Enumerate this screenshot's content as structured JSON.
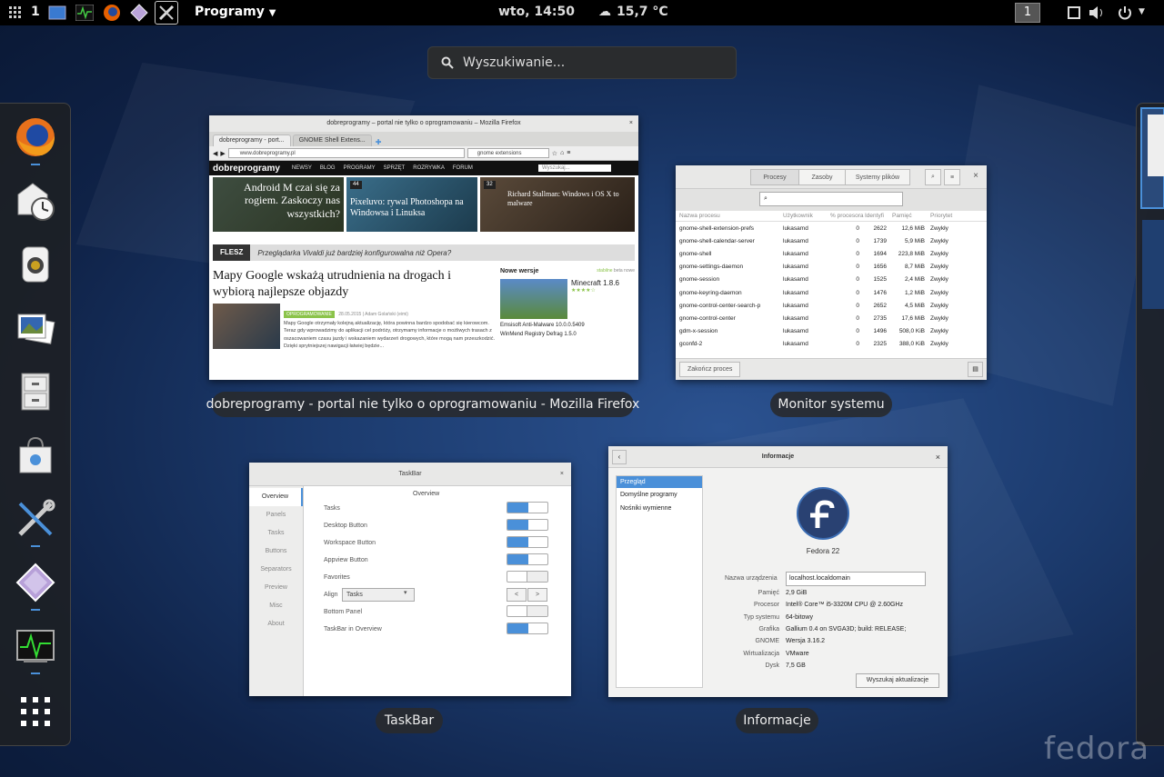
{
  "topbar": {
    "workspace_num": "1",
    "apps_menu": "Programy",
    "clock": "wto, 14:50",
    "weather": "15,7 °C",
    "workspace_indicator": "1"
  },
  "search": {
    "placeholder": "Wyszukiwanie..."
  },
  "dash": {
    "items": [
      "firefox",
      "mail-clock",
      "speaker",
      "image-viewer",
      "file-cabinet",
      "software-store",
      "tweak-tool",
      "gem-app",
      "system-monitor",
      "show-apps"
    ]
  },
  "windows": {
    "firefox": {
      "caption": "dobreprogramy - portal nie tylko o oprogramowaniu - Mozilla Firefox",
      "title": "dobreprogramy – portal nie tylko o oprogramowaniu – Mozilla Firefox",
      "tab1": "dobreprogramy - port...",
      "tab2": "GNOME Shell Extens...",
      "url": "www.dobreprogramy.pl",
      "search": "gnome extensions",
      "site_logo": "dobreprogramy",
      "nav": [
        "NEWSY",
        "BLOG",
        "PROGRAMY",
        "SPRZĘT",
        "ROZRYWKA",
        "FORUM"
      ],
      "site_search": "Wyszukaj...",
      "card1": "Android M czai się za rogiem. Zaskoczy nas wszystkich?",
      "card2": "Pixeluvo: rywal Photoshopa na Windowsa i Linuksa",
      "card2_badge": "44",
      "card3": "Richard Stallman: Windows i OS X to malware",
      "card3_badge": "32",
      "flesz_label": "FLESZ",
      "flesz_text": "Przeglądarka Vivaldi już bardziej konfigurowalna niż Opera?",
      "headline": "Mapy Google wskażą utrudnienia na drogach i wybiorą najlepsze objazdy",
      "headline_badge": "5",
      "tag": "OPROGRAMOWANIE",
      "meta": "28.05.2015 | Adam Golański (eimi)",
      "body": "Mapy Google otrzymały kolejną aktualizację, która powinna bardzo spodobać się kierowcom. Teraz gdy wprowadzimy do aplikacji cel podróży, otrzymamy informacje o możliwych trasach z oszacowaniem czasu jazdy i wskazaniem wydarzeń drogowych, które mogą nam przeszkodzić. Dzięki sprytniejszej nawigacji łatwiej będzie...",
      "new_versions": "Nowe wersje",
      "nv_tabs": [
        "stabilne",
        "beta",
        "nowe"
      ],
      "minecraft": "Minecraft 1.8.6",
      "nv1": "Emsisoft Anti-Malware 10.0.0.5409",
      "nv2": "WinMend Registry Defrag 1.5.0"
    },
    "monitor": {
      "caption": "Monitor systemu",
      "tabs": [
        "Procesy",
        "Zasoby",
        "Systemy plików"
      ],
      "columns": [
        "Nazwa procesu",
        "Użytkownik",
        "% procesora",
        "Identyfi",
        "Pamięć",
        "Priorytet"
      ],
      "rows": [
        [
          "gnome-shell-extension-prefs",
          "lukasamd",
          "0",
          "2622",
          "12,6 MiB",
          "Zwykły"
        ],
        [
          "gnome-shell-calendar-server",
          "lukasamd",
          "0",
          "1739",
          "5,9 MiB",
          "Zwykły"
        ],
        [
          "gnome-shell",
          "lukasamd",
          "0",
          "1694",
          "223,8 MiB",
          "Zwykły"
        ],
        [
          "gnome-settings-daemon",
          "lukasamd",
          "0",
          "1656",
          "8,7 MiB",
          "Zwykły"
        ],
        [
          "gnome-session",
          "lukasamd",
          "0",
          "1525",
          "2,4 MiB",
          "Zwykły"
        ],
        [
          "gnome-keyring-daemon",
          "lukasamd",
          "0",
          "1476",
          "1,2 MiB",
          "Zwykły"
        ],
        [
          "gnome-control-center-search-p",
          "lukasamd",
          "0",
          "2652",
          "4,5 MiB",
          "Zwykły"
        ],
        [
          "gnome-control-center",
          "lukasamd",
          "0",
          "2735",
          "17,6 MiB",
          "Zwykły"
        ],
        [
          "gdm-x-session",
          "lukasamd",
          "0",
          "1496",
          "508,0 KiB",
          "Zwykły"
        ],
        [
          "gconfd-2",
          "lukasamd",
          "0",
          "2325",
          "388,0 KiB",
          "Zwykły"
        ]
      ],
      "end_button": "Zakończ proces"
    },
    "taskbar": {
      "caption": "TaskBar",
      "title": "TaskBar",
      "sidebar": [
        "Overview",
        "Panels",
        "Tasks",
        "Buttons",
        "Separators",
        "Preview",
        "Misc",
        "About"
      ],
      "heading": "Overview",
      "rows": [
        {
          "label": "Tasks",
          "state": "on"
        },
        {
          "label": "Desktop Button",
          "state": "on"
        },
        {
          "label": "Workspace Button",
          "state": "on"
        },
        {
          "label": "Appview Button",
          "state": "on"
        },
        {
          "label": "Favorites",
          "state": "off"
        },
        {
          "label": "Align",
          "state": "select"
        },
        {
          "label": "Bottom Panel",
          "state": "off"
        },
        {
          "label": "TaskBar in Overview",
          "state": "on"
        }
      ],
      "align_value": "Tasks"
    },
    "info": {
      "caption": "Informacje",
      "title": "Informacje",
      "sidebar": [
        "Przegląd",
        "Domyślne programy",
        "Nośniki wymienne"
      ],
      "os_name": "Fedora 22",
      "device_label": "Nazwa urządzenia",
      "device_name": "localhost.localdomain",
      "fields": [
        [
          "Pamięć",
          "2,9 GiB"
        ],
        [
          "Procesor",
          "Intel® Core™ i5-3320M CPU @ 2.60GHz"
        ],
        [
          "Typ systemu",
          "64-bitowy"
        ],
        [
          "Grafika",
          "Gallium 0.4 on SVGA3D; build: RELEASE;"
        ],
        [
          "GNOME",
          "Wersja 3.16.2"
        ],
        [
          "Wirtualizacja",
          "VMware"
        ],
        [
          "Dysk",
          "7,5 GB"
        ]
      ],
      "update_button": "Wyszukaj aktualizacje"
    }
  },
  "watermark": "fedora",
  "colors": {
    "accent": "#4a90d9",
    "panel": "#000000",
    "bg": "#1c3b6e"
  }
}
